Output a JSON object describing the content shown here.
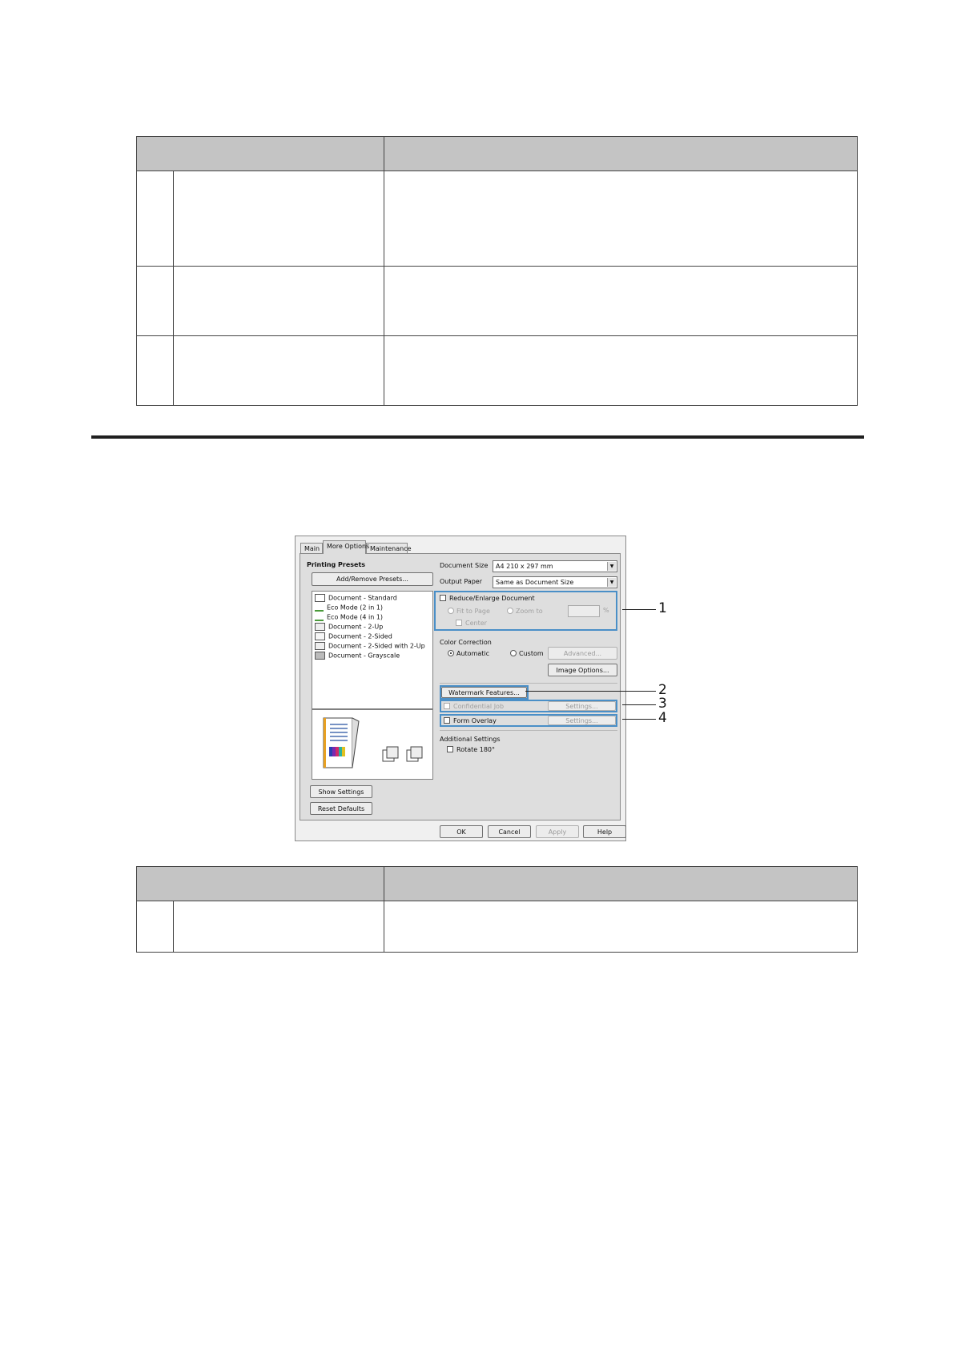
{
  "dialog": {
    "tabs": [
      "Main",
      "More Options",
      "Maintenance"
    ],
    "printing_presets": {
      "title": "Printing Presets",
      "add_remove_button": "Add/Remove Presets...",
      "items": [
        "Document - Standard",
        "Eco Mode (2 in 1)",
        "Eco Mode (4 in 1)",
        "Document - 2-Up",
        "Document - 2-Sided",
        "Document - 2-Sided with 2-Up",
        "Document - Grayscale"
      ],
      "show_settings_button": "Show Settings",
      "reset_defaults_button": "Reset Defaults"
    },
    "document_size": {
      "label": "Document Size",
      "value": "A4 210 x 297 mm"
    },
    "output_paper": {
      "label": "Output Paper",
      "value": "Same as Document Size"
    },
    "reduce_enlarge": {
      "label": "Reduce/Enlarge Document",
      "fit_to_page": "Fit to Page",
      "zoom_to": "Zoom to",
      "center": "Center",
      "percent": "%"
    },
    "color_correction": {
      "label": "Color Correction",
      "automatic": "Automatic",
      "custom": "Custom",
      "advanced_button": "Advanced...",
      "image_options_button": "Image Options..."
    },
    "watermark_features_button": "Watermark Features...",
    "confidential_job": {
      "label": "Confidential Job",
      "settings_button": "Settings..."
    },
    "form_overlay": {
      "label": "Form Overlay",
      "settings_button": "Settings..."
    },
    "additional_settings": {
      "label": "Additional Settings",
      "rotate_180": "Rotate 180°"
    },
    "footer": {
      "ok": "OK",
      "cancel": "Cancel",
      "apply": "Apply",
      "help": "Help"
    }
  },
  "callouts": [
    "1",
    "2",
    "3",
    "4"
  ],
  "colors": {
    "highlight": "#4a8fc7",
    "table_header": "#c4c4c4"
  }
}
